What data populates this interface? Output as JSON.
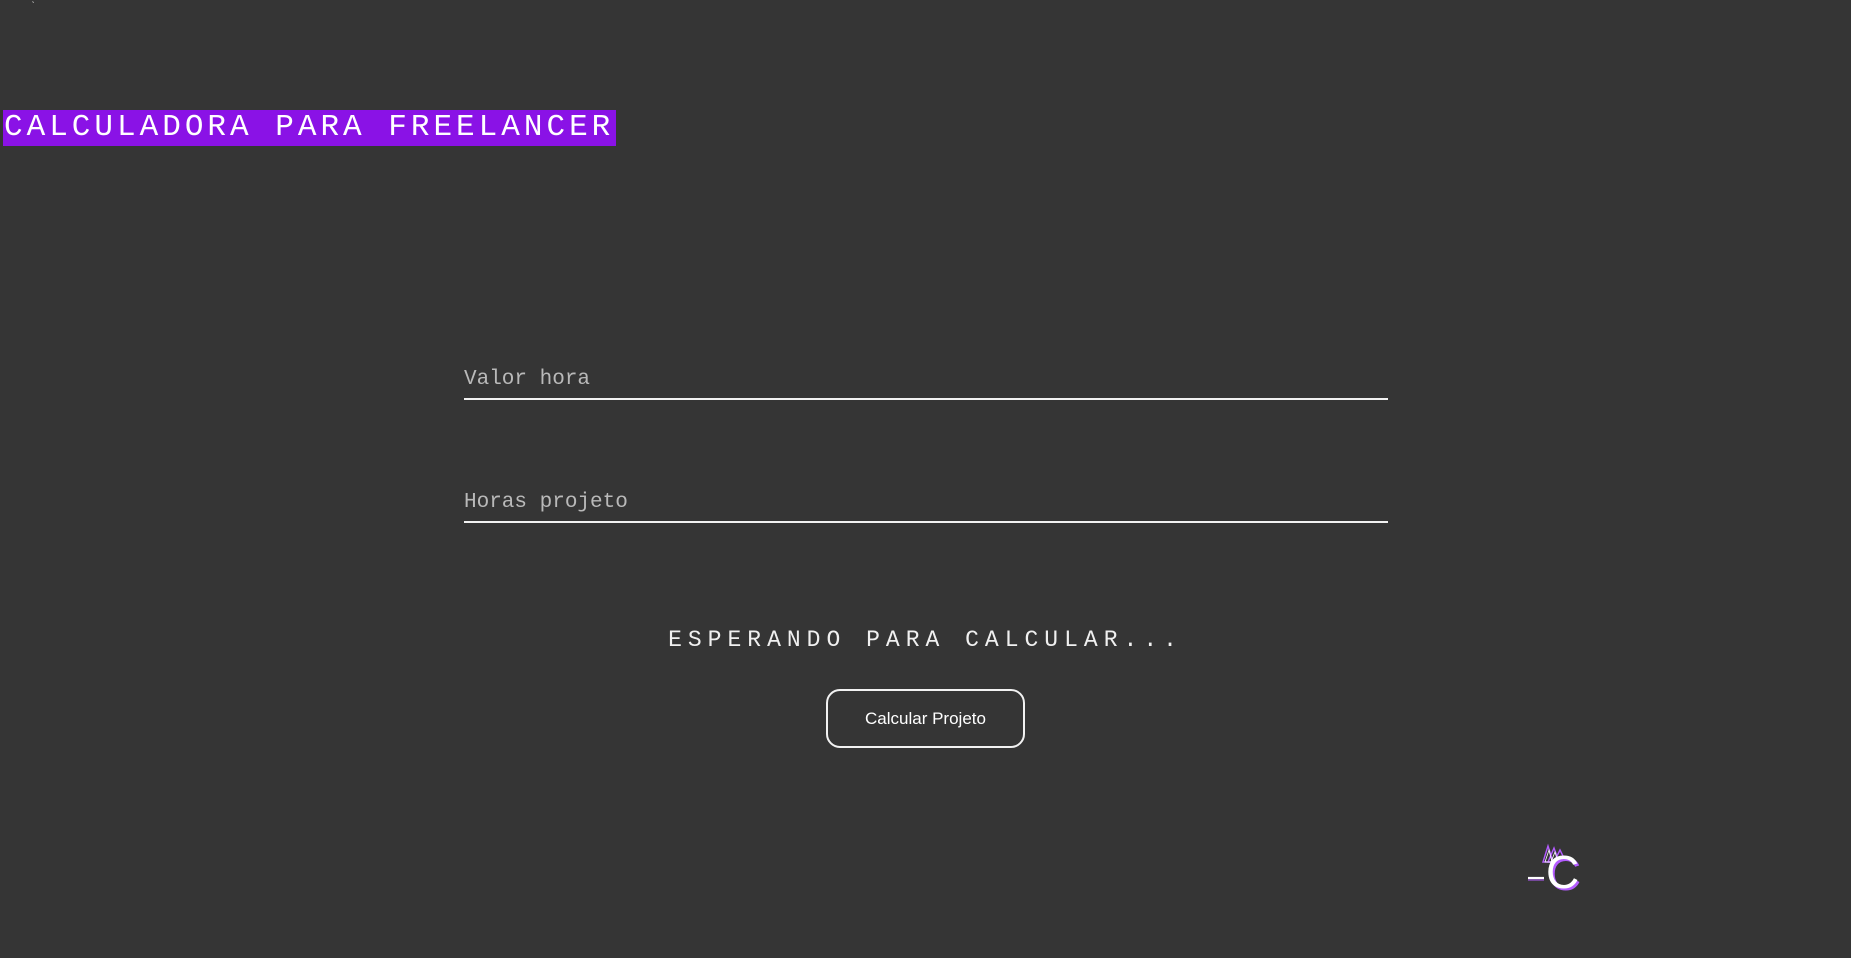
{
  "corner_mark": "ˎ",
  "header": {
    "title": "CALCULADORA PARA FREELANCER"
  },
  "form": {
    "valor_hora": {
      "placeholder": "Valor hora",
      "value": ""
    },
    "horas_projeto": {
      "placeholder": "Horas projeto",
      "value": ""
    }
  },
  "result": {
    "status_text": "ESPERANDO PARA CALCULAR..."
  },
  "actions": {
    "calculate_label": "Calcular Projeto"
  },
  "logo": {
    "letter": "C",
    "icon": "crown-c-logo-icon"
  },
  "colors": {
    "background": "#353535",
    "accent": "#8a12e6",
    "text": "#ffffff",
    "logo_accent": "#b45cff"
  }
}
